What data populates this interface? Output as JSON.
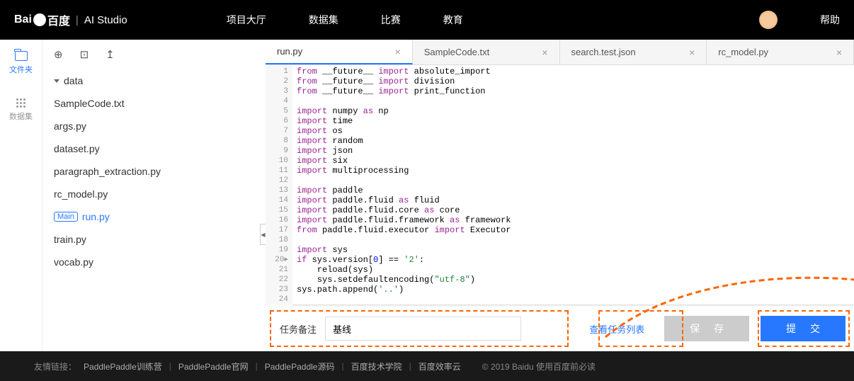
{
  "header": {
    "logo_brand": "百度",
    "logo_product": "AI Studio",
    "nav": [
      "项目大厅",
      "数据集",
      "比赛",
      "教育"
    ],
    "help": "帮助"
  },
  "leftbar": {
    "files": "文件夹",
    "dataset": "数据集"
  },
  "file_toolbar": {
    "new_file": "⊕",
    "new_folder": "⊡",
    "upload": "↥"
  },
  "filetree": {
    "folder": "data",
    "files": [
      "SampleCode.txt",
      "args.py",
      "dataset.py",
      "paragraph_extraction.py",
      "rc_model.py"
    ],
    "main_badge": "Main",
    "main_file": "run.py",
    "files_after": [
      "train.py",
      "vocab.py"
    ]
  },
  "tabs": [
    {
      "name": "run.py",
      "active": true
    },
    {
      "name": "SampleCode.txt",
      "active": false
    },
    {
      "name": "search.test.json",
      "active": false
    },
    {
      "name": "rc_model.py",
      "active": false
    }
  ],
  "code": {
    "line_count": 24,
    "line20_marker": "▸",
    "lines_html": "<span class='kw'>from</span> __future__ <span class='kw'>import</span> absolute_import\n<span class='kw'>from</span> __future__ <span class='kw'>import</span> division\n<span class='kw'>from</span> __future__ <span class='kw'>import</span> print_function\n\n<span class='kw'>import</span> numpy <span class='kw'>as</span> np\n<span class='kw'>import</span> time\n<span class='kw'>import</span> os\n<span class='kw'>import</span> random\n<span class='kw'>import</span> json\n<span class='kw'>import</span> six\n<span class='kw'>import</span> multiprocessing\n\n<span class='kw'>import</span> paddle\n<span class='kw'>import</span> paddle.fluid <span class='kw'>as</span> fluid\n<span class='kw'>import</span> paddle.fluid.core <span class='kw'>as</span> core\n<span class='kw'>import</span> paddle.fluid.framework <span class='kw'>as</span> framework\n<span class='kw'>from</span> paddle.fluid.executor <span class='kw'>import</span> Executor\n\n<span class='kw'>import</span> sys\n<span class='kw'>if</span> sys.version[<span class='num'>0</span>] == <span class='s'>'2'</span>:\n    reload(sys)\n    sys.setdefaultencoding(<span class='s'>\"utf-8\"</span>)\nsys.path.append(<span class='s'>'..'</span>)"
  },
  "action_bar": {
    "remark_label": "任务备注",
    "remark_value": "基线",
    "view_tasks": "查看任务列表",
    "save": "保 存",
    "submit": "提 交"
  },
  "footer": {
    "label": "友情链接：",
    "links": [
      "PaddlePaddle训练营",
      "PaddlePaddle官网",
      "PaddlePaddle源码",
      "百度技术学院",
      "百度效率云"
    ],
    "copyright": "© 2019 Baidu 使用百度前必读"
  }
}
